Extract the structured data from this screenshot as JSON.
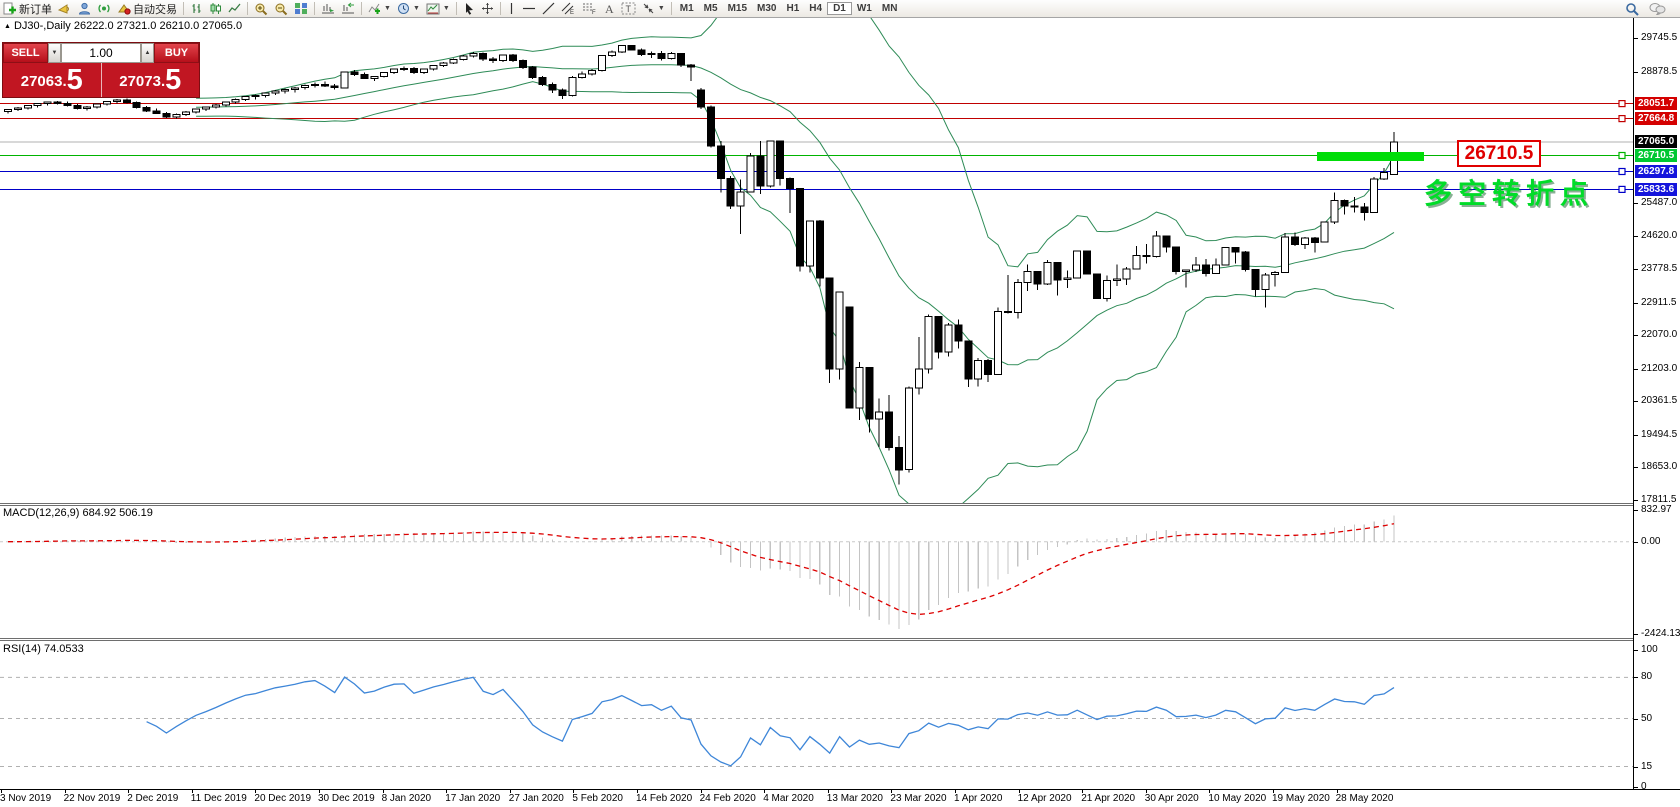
{
  "toolbar": {
    "new_order_label": "新订单",
    "auto_trade_label": "自动交易",
    "timeframes": [
      "M1",
      "M5",
      "M15",
      "M30",
      "H1",
      "H4",
      "D1",
      "W1",
      "MN"
    ],
    "active_timeframe": "D1"
  },
  "chart": {
    "title": "DJ30-,Daily 26222.0 27321.0 26210.0 27065.0",
    "symbol": "DJ30-",
    "period": "Daily",
    "ohlc": {
      "open": "26222.0",
      "high": "27321.0",
      "low": "26210.0",
      "close": "27065.0"
    }
  },
  "trade_panel": {
    "sell_label": "SELL",
    "buy_label": "BUY",
    "volume": "1.00",
    "sell_price_small": "27063.",
    "sell_price_big": "5",
    "buy_price_small": "27073.",
    "buy_price_big": "5"
  },
  "price_axis": {
    "ticks": [
      29745.5,
      28878.5,
      25487.0,
      24620.0,
      23778.5,
      22911.5,
      22070.0,
      21203.0,
      20361.5,
      19494.5,
      18653.0,
      17811.5
    ],
    "levels": [
      {
        "label": "28051.7",
        "price": 28051.7,
        "color": "#d40000",
        "line_color": "#c00000",
        "current": false
      },
      {
        "label": "27664.8",
        "price": 27664.8,
        "color": "#d40000",
        "line_color": "#c00000",
        "current": false
      },
      {
        "label": "27065.0",
        "price": 27065.0,
        "color": "#000000",
        "line_color": "#b0b0b0",
        "current": true
      },
      {
        "label": "26710.5",
        "price": 26710.5,
        "color": "#00c832",
        "line_color": "#00b400",
        "current": false
      },
      {
        "label": "26297.8",
        "price": 26297.8,
        "color": "#1414dc",
        "line_color": "#0000c8",
        "current": false
      },
      {
        "label": "25833.6",
        "price": 25833.6,
        "color": "#1414dc",
        "line_color": "#0000c8",
        "current": false
      }
    ]
  },
  "macd": {
    "label": "MACD(12,26,9) 684.92 506.19",
    "ticks": [
      832.97,
      0.0,
      -2424.13
    ],
    "tick_labels": [
      "832.97",
      "0.00",
      "-2424.13"
    ]
  },
  "rsi": {
    "label": "RSI(14) 74.0533",
    "ticks": [
      100,
      80,
      50,
      15,
      0
    ],
    "tick_labels": [
      "100",
      "80",
      "50",
      "15",
      "0"
    ],
    "dashed_levels": [
      80,
      50,
      15
    ]
  },
  "date_axis": [
    "3 Nov 2019",
    "22 Nov 2019",
    "2 Dec 2019",
    "11 Dec 2019",
    "20 Dec 2019",
    "30 Dec 2019",
    "8 Jan 2020",
    "17 Jan 2020",
    "27 Jan 2020",
    "5 Feb 2020",
    "14 Feb 2020",
    "24 Feb 2020",
    "4 Mar 2020",
    "13 Mar 2020",
    "23 Mar 2020",
    "1 Apr 2020",
    "12 Apr 2020",
    "21 Apr 2020",
    "30 Apr 2020",
    "10 May 2020",
    "19 May 2020",
    "28 May 2020"
  ],
  "annotations": {
    "price_label": "26710.5",
    "note": "多空转折点",
    "highlight_color": "#00dd08"
  },
  "chart_data": {
    "type": "candlestick",
    "title": "DJ30- Daily",
    "symbol": "DJ30",
    "timeframe": "Daily",
    "y_range": [
      17811.5,
      29745.5
    ],
    "indicators": [
      "Bollinger Bands (20, 2)",
      "MACD(12,26,9)",
      "RSI(14)"
    ],
    "candles": [
      [
        27840,
        27910,
        27800,
        27900
      ],
      [
        27900,
        27960,
        27860,
        27940
      ],
      [
        27940,
        28010,
        27900,
        28000
      ],
      [
        28000,
        28060,
        27950,
        28050
      ],
      [
        28050,
        28110,
        28000,
        28090
      ],
      [
        28090,
        28120,
        28030,
        28060
      ],
      [
        28060,
        28100,
        27980,
        28000
      ],
      [
        28000,
        28040,
        27900,
        27930
      ],
      [
        27930,
        27990,
        27870,
        27960
      ],
      [
        27960,
        28050,
        27920,
        28040
      ],
      [
        28040,
        28120,
        28000,
        28100
      ],
      [
        28100,
        28170,
        28060,
        28150
      ],
      [
        28150,
        28180,
        28050,
        28080
      ],
      [
        28080,
        28100,
        27930,
        27950
      ],
      [
        27950,
        27990,
        27830,
        27860
      ],
      [
        27860,
        27920,
        27780,
        27800
      ],
      [
        27800,
        27840,
        27680,
        27700
      ],
      [
        27700,
        27790,
        27660,
        27770
      ],
      [
        27770,
        27860,
        27730,
        27840
      ],
      [
        27840,
        27930,
        27800,
        27910
      ],
      [
        27910,
        27980,
        27860,
        27960
      ],
      [
        27960,
        28040,
        27920,
        28020
      ],
      [
        28020,
        28110,
        27980,
        28090
      ],
      [
        28090,
        28180,
        28050,
        28160
      ],
      [
        28160,
        28250,
        28120,
        28230
      ],
      [
        28230,
        28290,
        28160,
        28260
      ],
      [
        28260,
        28340,
        28210,
        28320
      ],
      [
        28320,
        28400,
        28270,
        28380
      ],
      [
        28380,
        28440,
        28310,
        28420
      ],
      [
        28420,
        28480,
        28340,
        28460
      ],
      [
        28460,
        28540,
        28410,
        28520
      ],
      [
        28520,
        28600,
        28470,
        28550
      ],
      [
        28550,
        28620,
        28480,
        28510
      ],
      [
        28510,
        28560,
        28420,
        28460
      ],
      [
        28460,
        28880,
        28440,
        28870
      ],
      [
        28870,
        28920,
        28760,
        28800
      ],
      [
        28800,
        28850,
        28680,
        28700
      ],
      [
        28700,
        28770,
        28640,
        28750
      ],
      [
        28750,
        28870,
        28720,
        28860
      ],
      [
        28860,
        28960,
        28820,
        28950
      ],
      [
        28950,
        29010,
        28890,
        28960
      ],
      [
        28960,
        28990,
        28820,
        28860
      ],
      [
        28860,
        28950,
        28820,
        28940
      ],
      [
        28940,
        29050,
        28910,
        29030
      ],
      [
        29030,
        29130,
        28990,
        29100
      ],
      [
        29100,
        29220,
        29070,
        29190
      ],
      [
        29190,
        29300,
        29160,
        29280
      ],
      [
        29280,
        29380,
        29240,
        29350
      ],
      [
        29350,
        29370,
        29150,
        29200
      ],
      [
        29200,
        29260,
        29100,
        29160
      ],
      [
        29160,
        29320,
        29130,
        29300
      ],
      [
        29300,
        29330,
        29120,
        29160
      ],
      [
        29160,
        29190,
        28940,
        28990
      ],
      [
        28990,
        29020,
        28680,
        28720
      ],
      [
        28720,
        28760,
        28500,
        28540
      ],
      [
        28540,
        28600,
        28320,
        28400
      ],
      [
        28400,
        28440,
        28170,
        28260
      ],
      [
        28260,
        28760,
        28240,
        28730
      ],
      [
        28730,
        28880,
        28700,
        28810
      ],
      [
        28810,
        28950,
        28780,
        28900
      ],
      [
        28900,
        29310,
        28880,
        29290
      ],
      [
        29290,
        29420,
        29260,
        29380
      ],
      [
        29380,
        29570,
        29360,
        29550
      ],
      [
        29550,
        29560,
        29420,
        29440
      ],
      [
        29440,
        29480,
        29280,
        29320
      ],
      [
        29320,
        29400,
        29230,
        29350
      ],
      [
        29350,
        29410,
        29160,
        29220
      ],
      [
        29220,
        29390,
        29190,
        29350
      ],
      [
        29350,
        29360,
        29000,
        29050
      ],
      [
        29050,
        29080,
        28630,
        28990
      ],
      [
        28400,
        28460,
        27910,
        27960
      ],
      [
        27960,
        28000,
        26920,
        26960
      ],
      [
        26960,
        27090,
        25750,
        26120
      ],
      [
        26120,
        26180,
        25330,
        25410
      ],
      [
        25410,
        26090,
        24680,
        25770
      ],
      [
        25770,
        26780,
        25750,
        26700
      ],
      [
        26700,
        27080,
        25710,
        25920
      ],
      [
        25920,
        27090,
        25880,
        27090
      ],
      [
        27090,
        27100,
        25940,
        26120
      ],
      [
        26120,
        26140,
        25220,
        25860
      ],
      [
        25860,
        25860,
        23710,
        23850
      ],
      [
        23850,
        25020,
        23690,
        25020
      ],
      [
        25020,
        25040,
        23330,
        23550
      ],
      [
        23550,
        23550,
        20840,
        21200
      ],
      [
        21200,
        23190,
        20930,
        23190
      ],
      [
        22800,
        22800,
        20450,
        20190
      ],
      [
        20190,
        21380,
        19880,
        21240
      ],
      [
        21240,
        21240,
        19560,
        19900
      ],
      [
        19900,
        20440,
        19180,
        20090
      ],
      [
        20090,
        20530,
        19090,
        19170
      ],
      [
        19170,
        19470,
        18210,
        18590
      ],
      [
        18600,
        20740,
        18520,
        20700
      ],
      [
        20700,
        22020,
        20540,
        21200
      ],
      [
        21200,
        22600,
        21080,
        22550
      ],
      [
        22550,
        22550,
        21470,
        21640
      ],
      [
        21640,
        22380,
        21520,
        22330
      ],
      [
        22330,
        22480,
        21720,
        21920
      ],
      [
        21920,
        21920,
        20730,
        20940
      ],
      [
        20940,
        21480,
        20740,
        21410
      ],
      [
        21410,
        21460,
        20860,
        21050
      ],
      [
        21050,
        22780,
        21050,
        22680
      ],
      [
        22680,
        23620,
        22630,
        22650
      ],
      [
        22650,
        23520,
        22500,
        23430
      ],
      [
        23430,
        23900,
        23210,
        23720
      ],
      [
        23720,
        23720,
        23230,
        23390
      ],
      [
        23390,
        24010,
        23360,
        23950
      ],
      [
        23950,
        23950,
        23090,
        23500
      ],
      [
        23500,
        23740,
        23290,
        23540
      ],
      [
        23540,
        24260,
        23540,
        24240
      ],
      [
        24240,
        24240,
        23650,
        23650
      ],
      [
        23650,
        23660,
        23000,
        23020
      ],
      [
        23020,
        23610,
        22940,
        23480
      ],
      [
        23480,
        23890,
        23340,
        23520
      ],
      [
        23520,
        23830,
        23370,
        23780
      ],
      [
        23780,
        24370,
        23780,
        24130
      ],
      [
        24130,
        24430,
        23920,
        24100
      ],
      [
        24100,
        24760,
        24070,
        24630
      ],
      [
        24630,
        24630,
        24200,
        24350
      ],
      [
        24350,
        24350,
        23640,
        23720
      ],
      [
        23720,
        23760,
        23300,
        23750
      ],
      [
        23750,
        24090,
        23700,
        23880
      ],
      [
        23880,
        24040,
        23580,
        23660
      ],
      [
        23660,
        24050,
        23660,
        23880
      ],
      [
        23880,
        24350,
        23880,
        24330
      ],
      [
        24330,
        24330,
        23920,
        24220
      ],
      [
        24220,
        24240,
        23710,
        23760
      ],
      [
        23760,
        23760,
        23070,
        23250
      ],
      [
        23250,
        23680,
        22790,
        23630
      ],
      [
        23630,
        23730,
        23330,
        23690
      ],
      [
        23690,
        24710,
        23690,
        24600
      ],
      [
        24600,
        24720,
        24370,
        24410
      ],
      [
        24410,
        24610,
        24290,
        24580
      ],
      [
        24580,
        24600,
        24200,
        24470
      ],
      [
        24470,
        25010,
        24460,
        24995
      ],
      [
        24995,
        25750,
        24940,
        25548
      ],
      [
        25548,
        25580,
        25180,
        25400
      ],
      [
        25400,
        25640,
        25240,
        25380
      ],
      [
        25380,
        25480,
        25030,
        25240
      ],
      [
        25240,
        26160,
        25240,
        26100
      ],
      [
        26100,
        26390,
        26080,
        26270
      ],
      [
        26222,
        27321,
        26210,
        27065
      ]
    ]
  }
}
